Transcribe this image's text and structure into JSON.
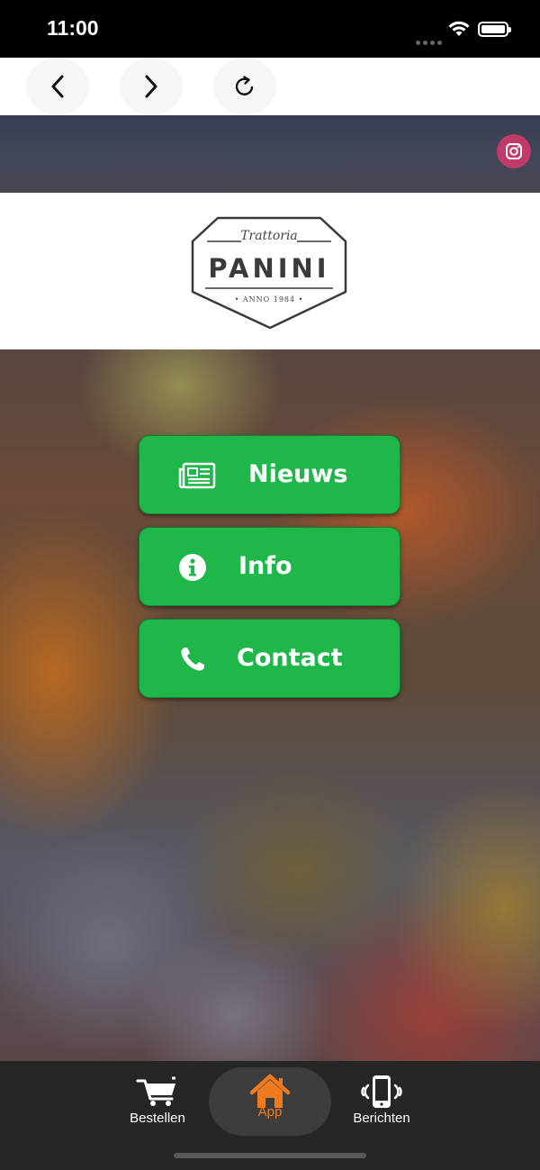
{
  "status_bar": {
    "time": "11:00"
  },
  "browser_nav": {
    "back": "back-icon",
    "forward": "forward-icon",
    "reload": "reload-icon"
  },
  "header": {
    "social": "instagram-icon",
    "social_color": "#c13b6a"
  },
  "logo": {
    "script": "Trattoria",
    "name": "PANINI",
    "anno": "• ANNO 1984 •"
  },
  "menu": [
    {
      "label": "Nieuws",
      "icon": "newspaper-icon"
    },
    {
      "label": "Info",
      "icon": "info-icon"
    },
    {
      "label": "Contact",
      "icon": "phone-icon"
    }
  ],
  "colors": {
    "button_green": "#1fb74a",
    "active_tab": "#f07b1f",
    "tab_bar": "#262626"
  },
  "tab_bar": {
    "tabs": [
      {
        "label": "Bestellen",
        "icon": "cart-icon",
        "active": false
      },
      {
        "label": "App",
        "icon": "home-icon",
        "active": true
      },
      {
        "label": "Berichten",
        "icon": "phone-vibrate-icon",
        "active": false
      }
    ]
  }
}
